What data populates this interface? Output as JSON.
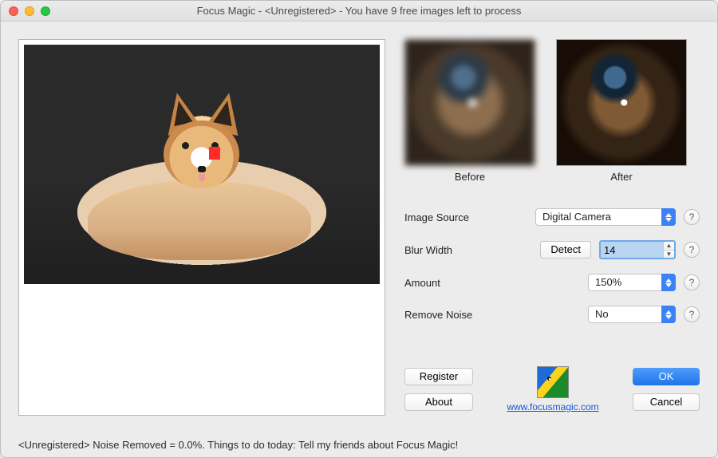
{
  "window": {
    "title": "Focus Magic - <Unregistered> - You have 9 free images left to process"
  },
  "preview": {
    "before_label": "Before",
    "after_label": "After"
  },
  "form": {
    "image_source": {
      "label": "Image Source",
      "value": "Digital Camera"
    },
    "blur_width": {
      "label": "Blur Width",
      "detect": "Detect",
      "value": "14"
    },
    "amount": {
      "label": "Amount",
      "value": "150%"
    },
    "remove_noise": {
      "label": "Remove Noise",
      "value": "No"
    }
  },
  "buttons": {
    "register": "Register",
    "about": "About",
    "ok": "OK",
    "cancel": "Cancel"
  },
  "logo": {
    "link_text": "www.focusmagic.com"
  },
  "footer": "<Unregistered> Noise Removed = 0.0%. Things to do today: Tell my friends about Focus Magic!"
}
